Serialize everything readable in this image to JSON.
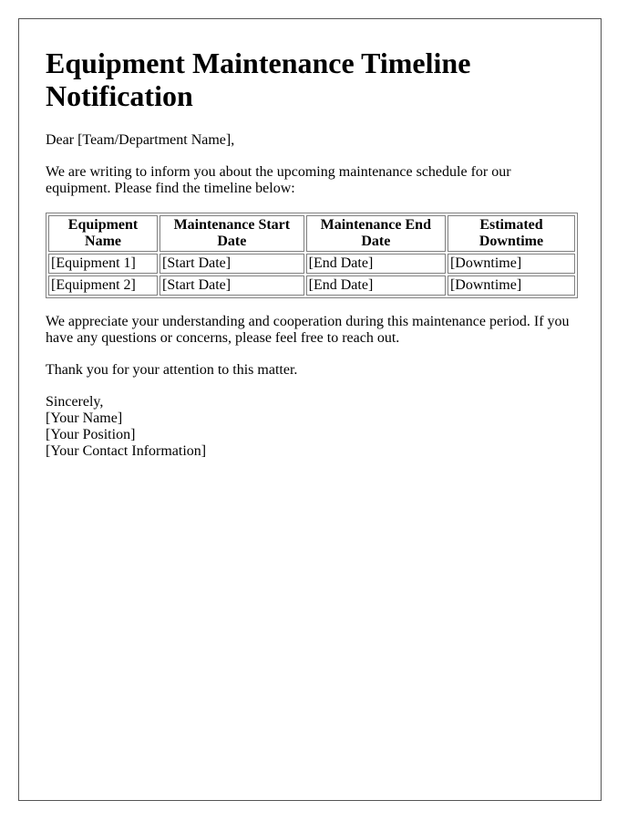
{
  "document": {
    "title": "Equipment Maintenance Timeline Notification",
    "salutation": "Dear [Team/Department Name],",
    "intro": "We are writing to inform you about the upcoming maintenance schedule for our equipment. Please find the timeline below:",
    "table": {
      "headers": [
        "Equipment Name",
        "Maintenance Start Date",
        "Maintenance End Date",
        "Estimated Downtime"
      ],
      "rows": [
        [
          "[Equipment 1]",
          "[Start Date]",
          "[End Date]",
          "[Downtime]"
        ],
        [
          "[Equipment 2]",
          "[Start Date]",
          "[End Date]",
          "[Downtime]"
        ]
      ]
    },
    "appreciation": "We appreciate your understanding and cooperation during this maintenance period. If you have any questions or concerns, please feel free to reach out.",
    "thanks": "Thank you for your attention to this matter.",
    "signature": {
      "closing": "Sincerely,",
      "name": "[Your Name]",
      "position": "[Your Position]",
      "contact": "[Your Contact Information]"
    }
  }
}
